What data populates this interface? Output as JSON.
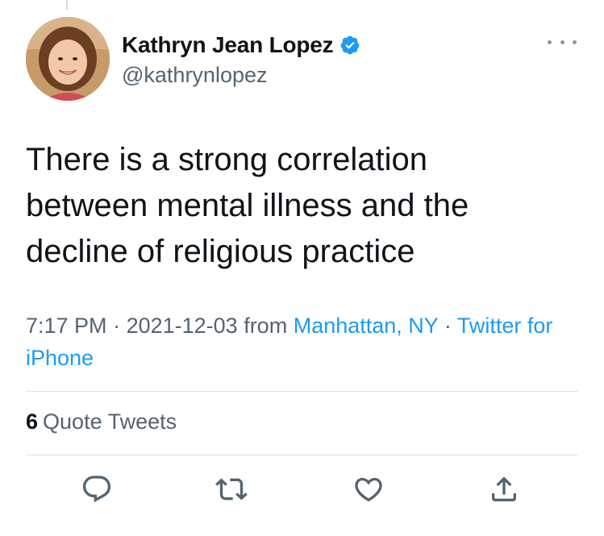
{
  "author": {
    "name": "Kathryn Jean Lopez",
    "handle": "@kathrynlopez",
    "verified": true,
    "avatar_icon": "profile-photo"
  },
  "tweet": {
    "text_lines": [
      "There is a strong correlation",
      "between mental illness and the",
      "decline of religious practice"
    ]
  },
  "meta": {
    "time": "7:17 PM",
    "sep1": " · ",
    "date": "2021-12-03",
    "from_label": " from ",
    "location": "Manhattan, NY",
    "sep2": " · ",
    "source": "Twitter for iPhone"
  },
  "stats": {
    "quote_count": "6",
    "quote_label": "Quote Tweets"
  },
  "actions": {
    "icons": [
      "reply-icon",
      "retweet-icon",
      "like-icon",
      "share-icon"
    ]
  },
  "colors": {
    "text": "#0f1419",
    "secondary": "#536471",
    "link": "#1d9bf0",
    "divider": "#dfe3e6"
  }
}
